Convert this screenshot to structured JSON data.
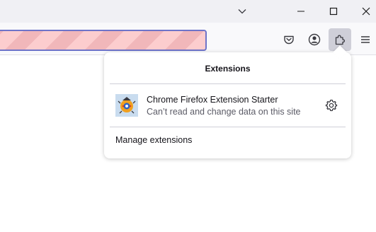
{
  "panel": {
    "title": "Extensions",
    "extension": {
      "name": "Chrome Firefox Extension Starter",
      "status": "Can’t read and change data on this site"
    },
    "manage_label": "Manage extensions"
  },
  "icons": {
    "tab_list": "chevron-down-icon",
    "minimize": "minimize-icon",
    "maximize": "maximize-icon",
    "close": "close-icon",
    "pocket": "pocket-icon",
    "account": "account-icon",
    "extensions": "puzzle-icon",
    "menu": "hamburger-menu-icon",
    "settings": "gear-icon"
  },
  "colors": {
    "urlbar_border": "#6e74c9",
    "urlbar_stripe_a": "#fccdce",
    "urlbar_stripe_b": "#f1b7ba",
    "active_button": "#cfcfd8"
  }
}
